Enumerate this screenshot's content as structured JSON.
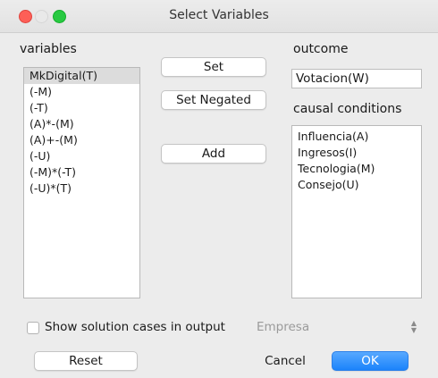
{
  "window": {
    "title": "Select Variables"
  },
  "variables": {
    "label": "variables",
    "items": [
      "MkDigital(T)",
      "(-M)",
      "(-T)",
      "(A)*-(M)",
      "(A)+-(M)",
      "(-U)",
      "(-M)*(-T)",
      "(-U)*(T)"
    ],
    "selected_index": 0
  },
  "buttons": {
    "set": "Set",
    "set_negated": "Set Negated",
    "add": "Add",
    "reset": "Reset",
    "cancel": "Cancel",
    "ok": "OK"
  },
  "outcome": {
    "label": "outcome",
    "value": "Votacion(W)"
  },
  "causal_conditions": {
    "label": "causal conditions",
    "items": [
      "Influencia(A)",
      "Ingresos(I)",
      "Tecnologia(M)",
      "Consejo(U)"
    ]
  },
  "options": {
    "show_cases_label": "Show solution cases in output",
    "show_cases_checked": false,
    "case_id_select": "Empresa"
  },
  "colors": {
    "accent": "#1b83fb",
    "close": "#fd5f57",
    "zoom": "#28c941"
  }
}
